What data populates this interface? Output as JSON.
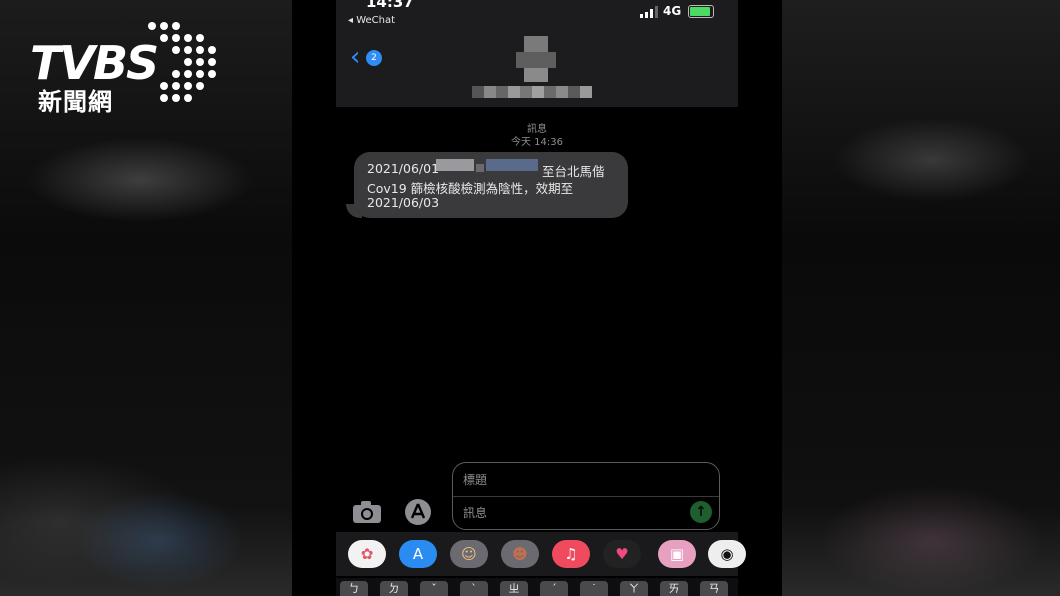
{
  "watermark": {
    "brand": "TVBS",
    "subtitle": "新聞網"
  },
  "status_bar": {
    "time": "14:37",
    "back_app": "◂ WeChat",
    "network": "4G"
  },
  "header": {
    "unread_count": "2"
  },
  "conversation": {
    "service": "訊息",
    "timestamp": "今天 14:36",
    "message_lines": [
      "2021/06/01",
      "至台北馬偕",
      "Cov19 篩檢核酸檢測為陰性，效期至",
      "2021/06/03"
    ]
  },
  "compose": {
    "subject_placeholder": "標題",
    "message_placeholder": "訊息"
  },
  "apps": [
    {
      "name": "photos",
      "glyph": "✿"
    },
    {
      "name": "app-store",
      "glyph": "A"
    },
    {
      "name": "memoji-1",
      "glyph": "☺"
    },
    {
      "name": "memoji-2",
      "glyph": "☻"
    },
    {
      "name": "music",
      "glyph": "♫"
    },
    {
      "name": "digital-touch",
      "glyph": "♥"
    },
    {
      "name": "images",
      "glyph": "▣"
    },
    {
      "name": "camera-effects",
      "glyph": "◉"
    }
  ],
  "keyboard": [
    "ㄅ",
    "ㄉ",
    "ˇ",
    "ˋ",
    "ㄓ",
    "ˊ",
    "˙",
    "ㄚ",
    "ㄞ",
    "ㄢ"
  ]
}
